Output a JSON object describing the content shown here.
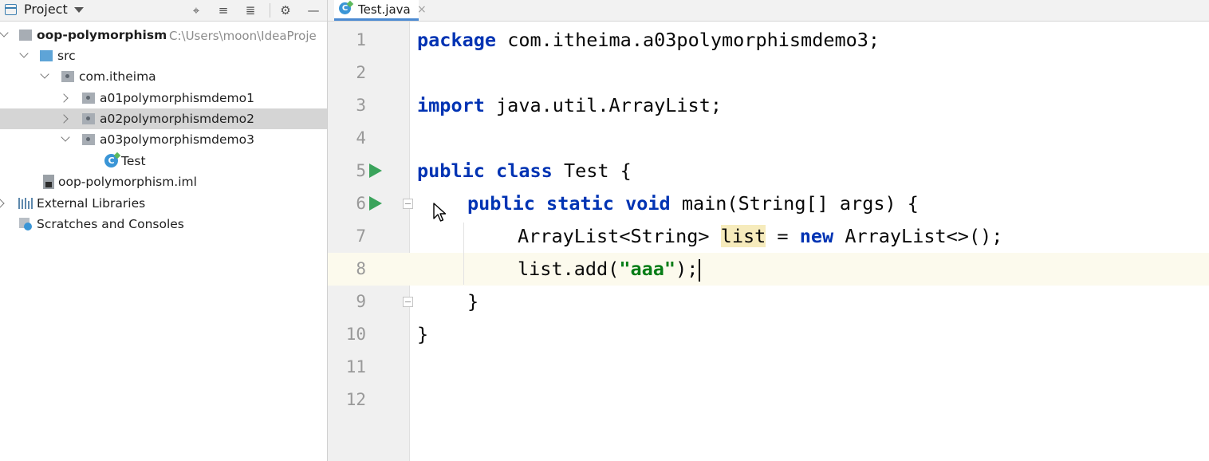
{
  "project_panel": {
    "title": "Project",
    "header_icons": [
      "locate-icon",
      "expand-all-icon",
      "collapse-all-icon",
      "gear-icon",
      "minimize-icon"
    ],
    "tree": {
      "project_name": "oop-polymorphism",
      "project_path": "C:\\Users\\moon\\IdeaProje",
      "src": "src",
      "package": "com.itheima",
      "demo1": "a01polymorphismdemo1",
      "demo2": "a02polymorphismdemo2",
      "demo3": "a03polymorphismdemo3",
      "class_test": "Test",
      "iml_file": "oop-polymorphism.iml",
      "external_libraries": "External Libraries",
      "scratches": "Scratches and Consoles"
    }
  },
  "editor": {
    "tab": {
      "label": "Test.java",
      "close": "×"
    },
    "line_numbers": [
      "1",
      "2",
      "3",
      "4",
      "5",
      "6",
      "7",
      "8",
      "9",
      "10",
      "11",
      "12"
    ],
    "current_line": 8,
    "code": {
      "l1_kw": "package",
      "l1_rest": " com.itheima.a03polymorphismdemo3;",
      "l3_kw": "import",
      "l3_rest": " java.util.ArrayList;",
      "l5_kw1": "public",
      "l5_kw2": "class",
      "l5_rest": " Test {",
      "l6_kw1": "public",
      "l6_kw2": "static",
      "l6_kw3": "void",
      "l6_rest": " main(String[] args) {",
      "l7_a": "ArrayList<String> ",
      "l7_var": "list",
      "l7_b": " = ",
      "l7_kw": "new",
      "l7_c": " ArrayList<>();",
      "l8_a": "list.add(",
      "l8_str": "\"aaa\"",
      "l8_b": ");",
      "l9": "}",
      "l10": "}"
    }
  },
  "colors": {
    "keyword": "#0033b3",
    "string": "#067d17",
    "run_icon": "#3aa35b",
    "tab_underline": "#4b8ad2",
    "selection": "#d5d5d5"
  }
}
